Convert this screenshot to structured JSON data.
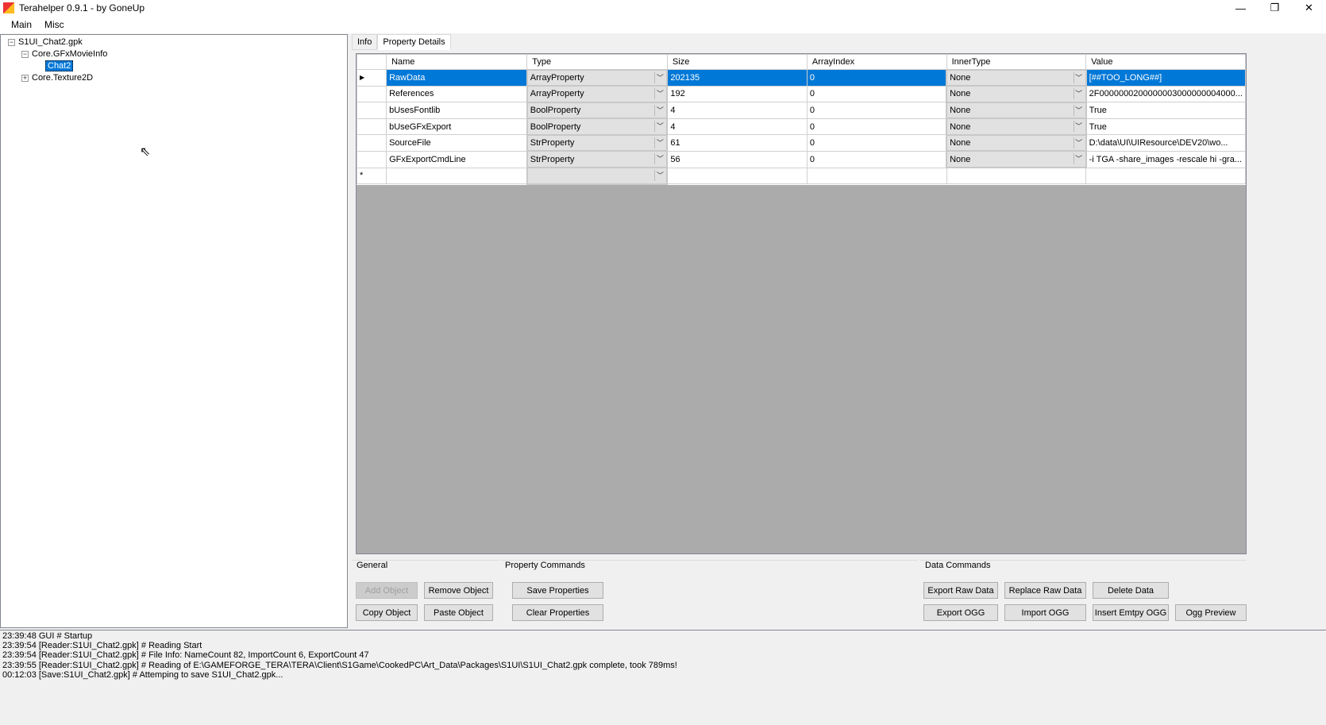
{
  "window": {
    "title": "Terahelper 0.9.1 - by GoneUp",
    "minimize": "—",
    "restore": "❐",
    "close": "✕"
  },
  "menu": [
    "Main",
    "Misc"
  ],
  "tree": {
    "root": "S1UI_Chat2.gpk",
    "children": [
      {
        "label": "Core.GFxMovieInfo",
        "expanded": true,
        "children": [
          {
            "label": "Chat2",
            "selected": true
          }
        ]
      },
      {
        "label": "Core.Texture2D",
        "expanded": false
      }
    ]
  },
  "tabs": [
    {
      "label": "Info",
      "active": false
    },
    {
      "label": "Property Details",
      "active": true
    }
  ],
  "grid": {
    "columns": [
      "Name",
      "Type",
      "Size",
      "ArrayIndex",
      "InnerType",
      "Value"
    ],
    "rows": [
      [
        "RawData",
        "ArrayProperty",
        "202135",
        "0",
        "None",
        "[##TOO_LONG##]"
      ],
      [
        "References",
        "ArrayProperty",
        "192",
        "0",
        "None",
        "2F0000000200000003000000004000..."
      ],
      [
        "bUsesFontlib",
        "BoolProperty",
        "4",
        "0",
        "None",
        "True"
      ],
      [
        "bUseGFxExport",
        "BoolProperty",
        "4",
        "0",
        "None",
        "True"
      ],
      [
        "SourceFile",
        "StrProperty",
        "61",
        "0",
        "None",
        "D:\\data\\UI\\UIResource\\DEV20\\wo..."
      ],
      [
        "GFxExportCmdLine",
        "StrProperty",
        "56",
        "0",
        "None",
        "-i TGA -share_images -rescale hi -gra..."
      ]
    ],
    "new_row_marker": "*",
    "current_marker": "▶"
  },
  "general": {
    "label": "General",
    "add": "Add Object",
    "remove": "Remove Object",
    "copy": "Copy Object",
    "paste": "Paste Object"
  },
  "property_commands": {
    "label": "Property Commands",
    "save": "Save Properties",
    "clear": "Clear Properties"
  },
  "data_commands": {
    "label": "Data Commands",
    "export_raw": "Export Raw Data",
    "replace_raw": "Replace Raw Data",
    "delete": "Delete Data",
    "export_ogg": "Export OGG",
    "import_ogg": "Import OGG",
    "insert_ogg": "Insert Emtpy OGG",
    "ogg_preview": "Ogg Preview"
  },
  "log": [
    "23:39:48 GUI # Startup",
    "23:39:54 [Reader:S1UI_Chat2.gpk] # Reading Start",
    "23:39:54 [Reader:S1UI_Chat2.gpk] # File Info: NameCount 82, ImportCount 6, ExportCount 47",
    "23:39:55 [Reader:S1UI_Chat2.gpk] # Reading of E:\\GAMEFORGE_TERA\\TERA\\Client\\S1Game\\CookedPC\\Art_Data\\Packages\\S1UI\\S1UI_Chat2.gpk complete, took 789ms!",
    "00:12:03 [Save:S1UI_Chat2.gpk] # Attemping to save S1UI_Chat2.gpk..."
  ]
}
